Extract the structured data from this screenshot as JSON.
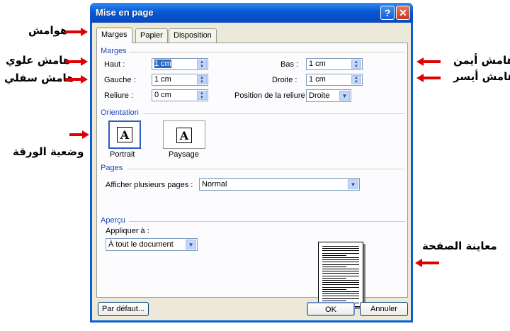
{
  "dialog": {
    "title": "Mise en page",
    "help_glyph": "?",
    "close_glyph": "✕",
    "tabs": [
      {
        "label": "Marges"
      },
      {
        "label": "Papier"
      },
      {
        "label": "Disposition"
      }
    ],
    "margins": {
      "section": "Marges",
      "top": {
        "label": "Haut :",
        "value": "1 cm"
      },
      "bottom": {
        "label": "Bas :",
        "value": "1 cm"
      },
      "left": {
        "label": "Gauche :",
        "value": "1 cm"
      },
      "right": {
        "label": "Droite :",
        "value": "1 cm"
      },
      "gutter": {
        "label": "Reliure :",
        "value": "0 cm"
      },
      "gutter_position": {
        "label": "Position de la reliure :",
        "value": "Droite"
      }
    },
    "orientation": {
      "section": "Orientation",
      "glyph": "A",
      "portrait": "Portrait",
      "landscape": "Paysage"
    },
    "pages": {
      "section": "Pages",
      "multiple_label": "Afficher plusieurs pages :",
      "multiple_value": "Normal"
    },
    "preview": {
      "section": "Aperçu",
      "apply_label": "Appliquer à :",
      "apply_value": "À tout le document"
    },
    "buttons": {
      "default": "Par défaut...",
      "ok": "OK",
      "cancel": "Annuler"
    }
  },
  "annotations": {
    "margins": "هوامش",
    "top_margin": "هامش علوي",
    "bottom_margin": "هامش سفلي",
    "right_margin": "هامش أيمن",
    "left_margin": "هامش أيسر",
    "orientation": "وضعية الورقة",
    "preview": "معاينة الصفحة"
  }
}
